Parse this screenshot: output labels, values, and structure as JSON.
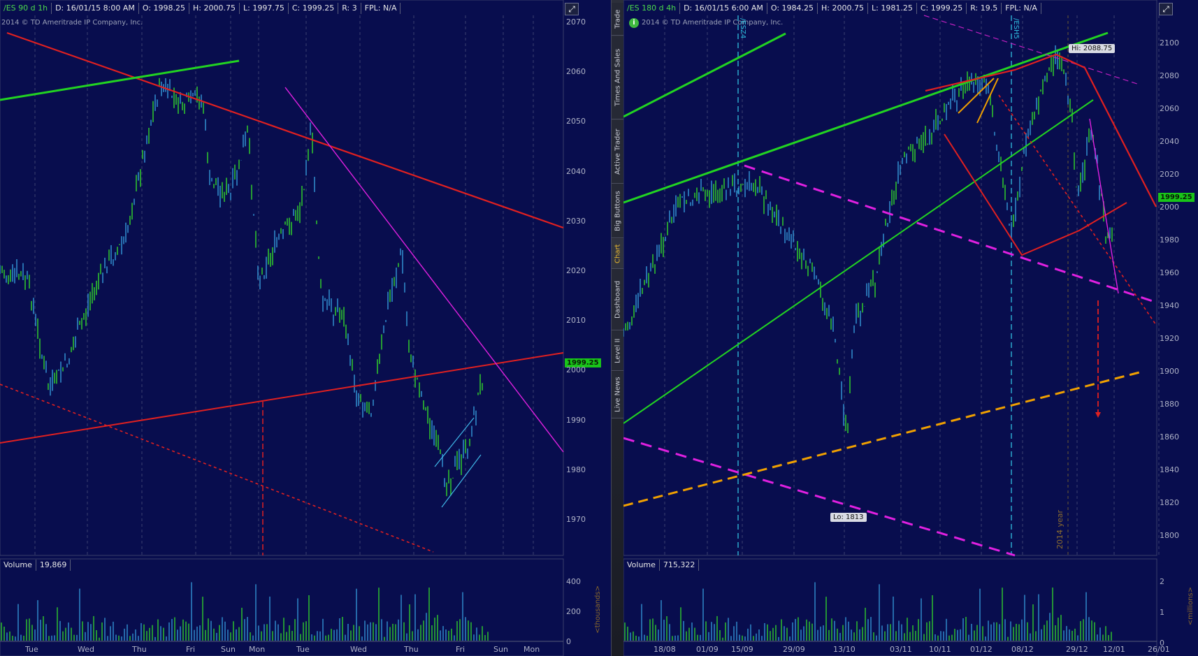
{
  "left": {
    "info": {
      "symbol": "/ES 90 d 1h",
      "date": "D: 16/01/15 8:00 AM",
      "open": "O: 1998.25",
      "high": "H: 2000.75",
      "low": "L: 1997.75",
      "close": "C: 1999.25",
      "range": "R: 3",
      "fpl": "FPL: N/A"
    },
    "copyright": "2014 © TD Ameritrade IP Company, Inc.",
    "price_tag": "1999.25",
    "price_levels": [
      "2070",
      "2060",
      "2050",
      "2040",
      "2030",
      "2020",
      "2010",
      "2000",
      "1990",
      "1980",
      "1970"
    ],
    "x_labels": [
      "Tue",
      "Wed",
      "Thu",
      "Fri",
      "Sun",
      "Mon",
      "Tue",
      "Wed",
      "Thu",
      "Fri",
      "Sun",
      "Mon"
    ],
    "volume_label": "Volume",
    "volume_value": "19,869",
    "volume_levels": [
      "400",
      "200",
      "0"
    ],
    "volume_unit": "<thousands>"
  },
  "right": {
    "info": {
      "symbol": "/ES 180 d 4h",
      "date": "D: 16/01/15 6:00 AM",
      "open": "O: 1984.25",
      "high": "H: 2000.75",
      "low": "L: 1981.25",
      "close": "C: 1999.25",
      "range": "R: 19.5",
      "fpl": "FPL: N/A"
    },
    "copyright": "2014 © TD Ameritrade IP Company, Inc.",
    "price_tag": "1999.25",
    "price_levels": [
      "2100",
      "2080",
      "2060",
      "2040",
      "2020",
      "2000",
      "1980",
      "1960",
      "1940",
      "1920",
      "1900",
      "1880",
      "1860",
      "1840",
      "1820",
      "1800"
    ],
    "x_labels": [
      "18/08",
      "01/09",
      "15/09",
      "29/09",
      "13/10",
      "03/11",
      "10/11",
      "01/12",
      "08/12",
      "29/12",
      "12/01",
      "26/01"
    ],
    "high_callout": "Hi: 2088.75",
    "low_callout": "Lo: 1813",
    "contract_labels": [
      "/ESZ4",
      "/ESH5"
    ],
    "year_label": "2014 year",
    "volume_label": "Volume",
    "volume_value": "715,322",
    "volume_levels": [
      "2",
      "1",
      "0"
    ],
    "volume_unit": "<millions>"
  },
  "sidebar_tabs": [
    "Trade",
    "Times And Sales",
    "Active Trader",
    "Big Buttons",
    "Chart",
    "Dashboard",
    "Level II",
    "Live News"
  ],
  "active_tab": "Chart",
  "colors": {
    "background": "#080d4e",
    "up_candle": "#2ec02e",
    "down_candle": "#2f88c8",
    "trend_red": "#e02020",
    "trend_green": "#22d322",
    "trend_magenta": "#e020e0",
    "trend_orange": "#f0a000",
    "cyan_line": "#30c0e0",
    "price_tag": "#19c419"
  }
}
